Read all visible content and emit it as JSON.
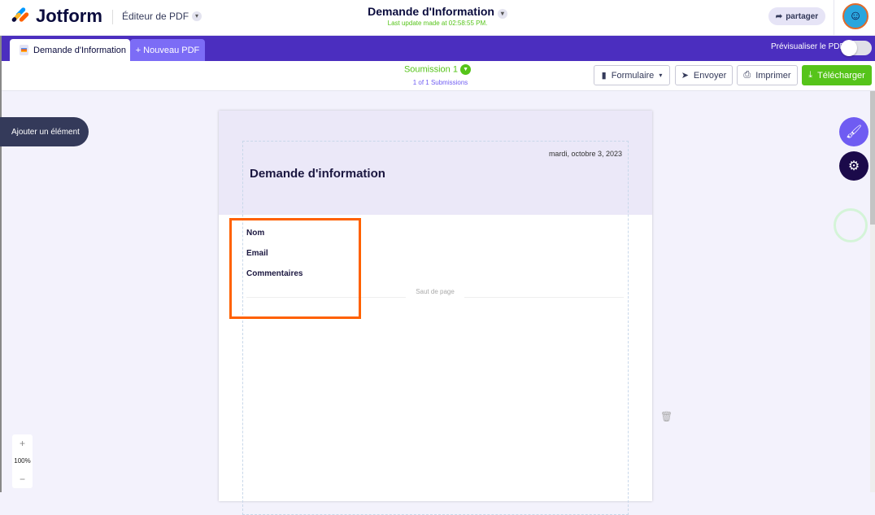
{
  "header": {
    "brand": "Jotform",
    "editor_label": "Éditeur de PDF",
    "doc_title": "Demande d'Information",
    "last_update": "Last update made at 02:58:55 PM.",
    "share_label": "partager"
  },
  "tabs": [
    {
      "label": "Demande d'Information"
    },
    {
      "label": "+ Nouveau PDF"
    }
  ],
  "preview_label": "Prévisualiser le PDF",
  "preview_on": false,
  "submission": {
    "label": "Soumission 1",
    "count": "1 of 1 Submissions"
  },
  "toolbar": {
    "form": "Formulaire",
    "send": "Envoyer",
    "print": "Imprimer",
    "download": "Télécharger"
  },
  "add_element": "Ajouter un élément",
  "document": {
    "date": "mardi, octobre 3, 2023",
    "title": "Demande d'information",
    "fields": [
      "Nom",
      "Email",
      "Commentaires"
    ],
    "page_break": "Saut de page"
  },
  "zoom": {
    "plus": "+",
    "level": "100%",
    "minus": "−"
  },
  "colors": {
    "accent": "#4b2ebf",
    "green": "#56c41a",
    "highlight": "#ff6100"
  }
}
